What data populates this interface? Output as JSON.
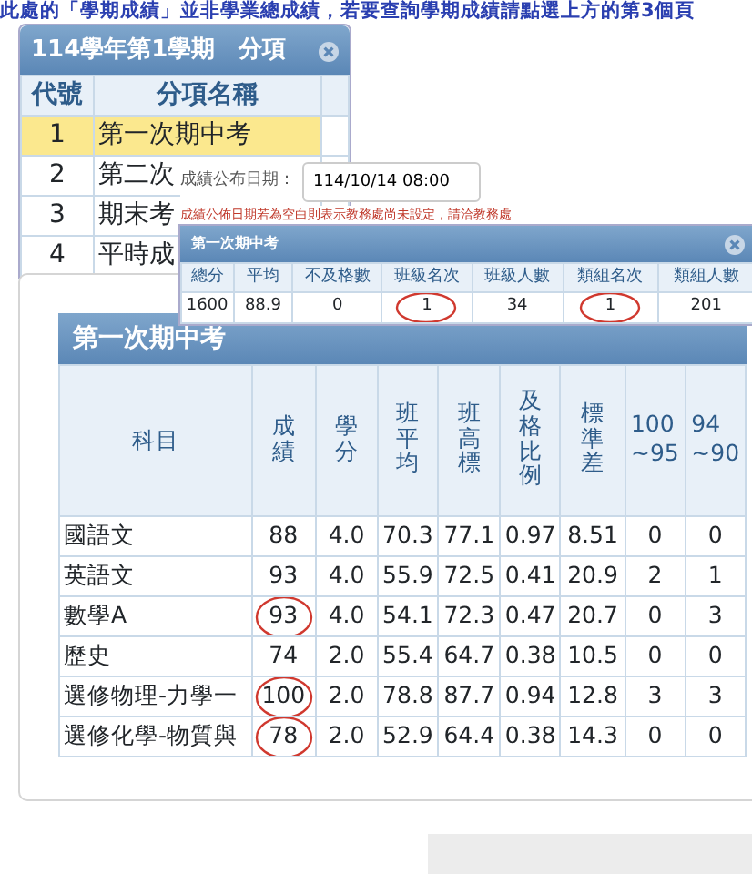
{
  "notice": "此處的「學期成績」並非學業總成績，若要查詢學期成績請點選上方的第3個頁",
  "items_window": {
    "title": "114學年第1學期　分項",
    "columns": [
      "代號",
      "分項名稱"
    ],
    "rows": [
      {
        "code": "1",
        "name": "第一次期中考",
        "selected": true
      },
      {
        "code": "2",
        "name": "第二次",
        "selected": false
      },
      {
        "code": "3",
        "name": "期末考",
        "selected": false
      },
      {
        "code": "4",
        "name": "平時成",
        "selected": false
      }
    ]
  },
  "publish": {
    "label": "成績公布日期：",
    "value": "114/10/14 08:00",
    "note": "成績公佈日期若為空白則表示教務處尚未設定，請洽教務處"
  },
  "summary_window": {
    "title": "第一次期中考",
    "columns": [
      "總分",
      "平均",
      "不及格數",
      "班級名次",
      "班級人數",
      "類組名次",
      "類組人數"
    ],
    "values": [
      {
        "text": "1600",
        "circled": false
      },
      {
        "text": "88.9",
        "circled": false
      },
      {
        "text": "0",
        "circled": false
      },
      {
        "text": "1",
        "circled": true
      },
      {
        "text": "34",
        "circled": false
      },
      {
        "text": "1",
        "circled": true
      },
      {
        "text": "201",
        "circled": false
      }
    ]
  },
  "grades_window": {
    "title": "第一次期中考",
    "columns": [
      "科目",
      "成績",
      "學分",
      "班平均",
      "班高標",
      "及格比例",
      "標準差",
      "100\n~95",
      "94\n~90"
    ],
    "rows": [
      {
        "circled": false,
        "cells": [
          "國語文",
          "88",
          "4.0",
          "70.3",
          "77.1",
          "0.97",
          "8.51",
          "0",
          "0"
        ]
      },
      {
        "circled": false,
        "cells": [
          "英語文",
          "93",
          "4.0",
          "55.9",
          "72.5",
          "0.41",
          "20.9",
          "2",
          "1"
        ]
      },
      {
        "circled": true,
        "cells": [
          "數學A",
          "93",
          "4.0",
          "54.1",
          "72.3",
          "0.47",
          "20.7",
          "0",
          "3"
        ]
      },
      {
        "circled": false,
        "cells": [
          "歷史",
          "74",
          "2.0",
          "55.4",
          "64.7",
          "0.38",
          "10.5",
          "0",
          "0"
        ]
      },
      {
        "circled": true,
        "cells": [
          "選修物理-力學一",
          "100",
          "2.0",
          "78.8",
          "87.7",
          "0.94",
          "12.8",
          "3",
          "3"
        ]
      },
      {
        "circled": true,
        "cells": [
          "選修化學-物質與",
          "78",
          "2.0",
          "52.9",
          "64.4",
          "0.38",
          "14.3",
          "0",
          "0"
        ]
      }
    ]
  }
}
